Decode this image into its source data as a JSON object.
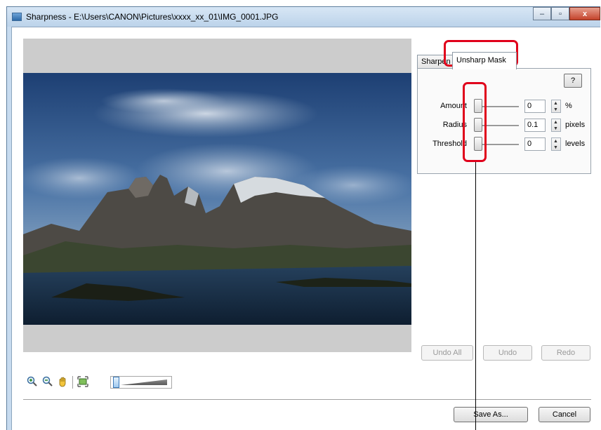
{
  "window": {
    "title": "Sharpness - E:\\Users\\CANON\\Pictures\\xxxx_xx_01\\IMG_0001.JPG",
    "minimize_glyph": "‒",
    "maximize_glyph": "▫",
    "close_glyph": "x"
  },
  "tabs": [
    {
      "label": "Sharpen",
      "active": false
    },
    {
      "label": "Unsharp Mask",
      "active": true
    }
  ],
  "panel": {
    "help_label": "?",
    "rows": [
      {
        "label": "Amount",
        "value": "0",
        "unit": "%"
      },
      {
        "label": "Radius",
        "value": "0.1",
        "unit": "pixels"
      },
      {
        "label": "Threshold",
        "value": "0",
        "unit": "levels"
      }
    ]
  },
  "actions": {
    "undo_all": "Undo All",
    "undo": "Undo",
    "redo": "Redo"
  },
  "footer": {
    "save_as": "Save As...",
    "cancel": "Cancel"
  },
  "icons": {
    "zoom_in": "zoom-in-icon",
    "zoom_out": "zoom-out-icon",
    "hand": "hand-icon",
    "fit": "fit-to-window-icon"
  },
  "colors": {
    "highlight": "#e0001b",
    "title_bar": "#c7dbef",
    "preview_bg": "#cccccc"
  }
}
